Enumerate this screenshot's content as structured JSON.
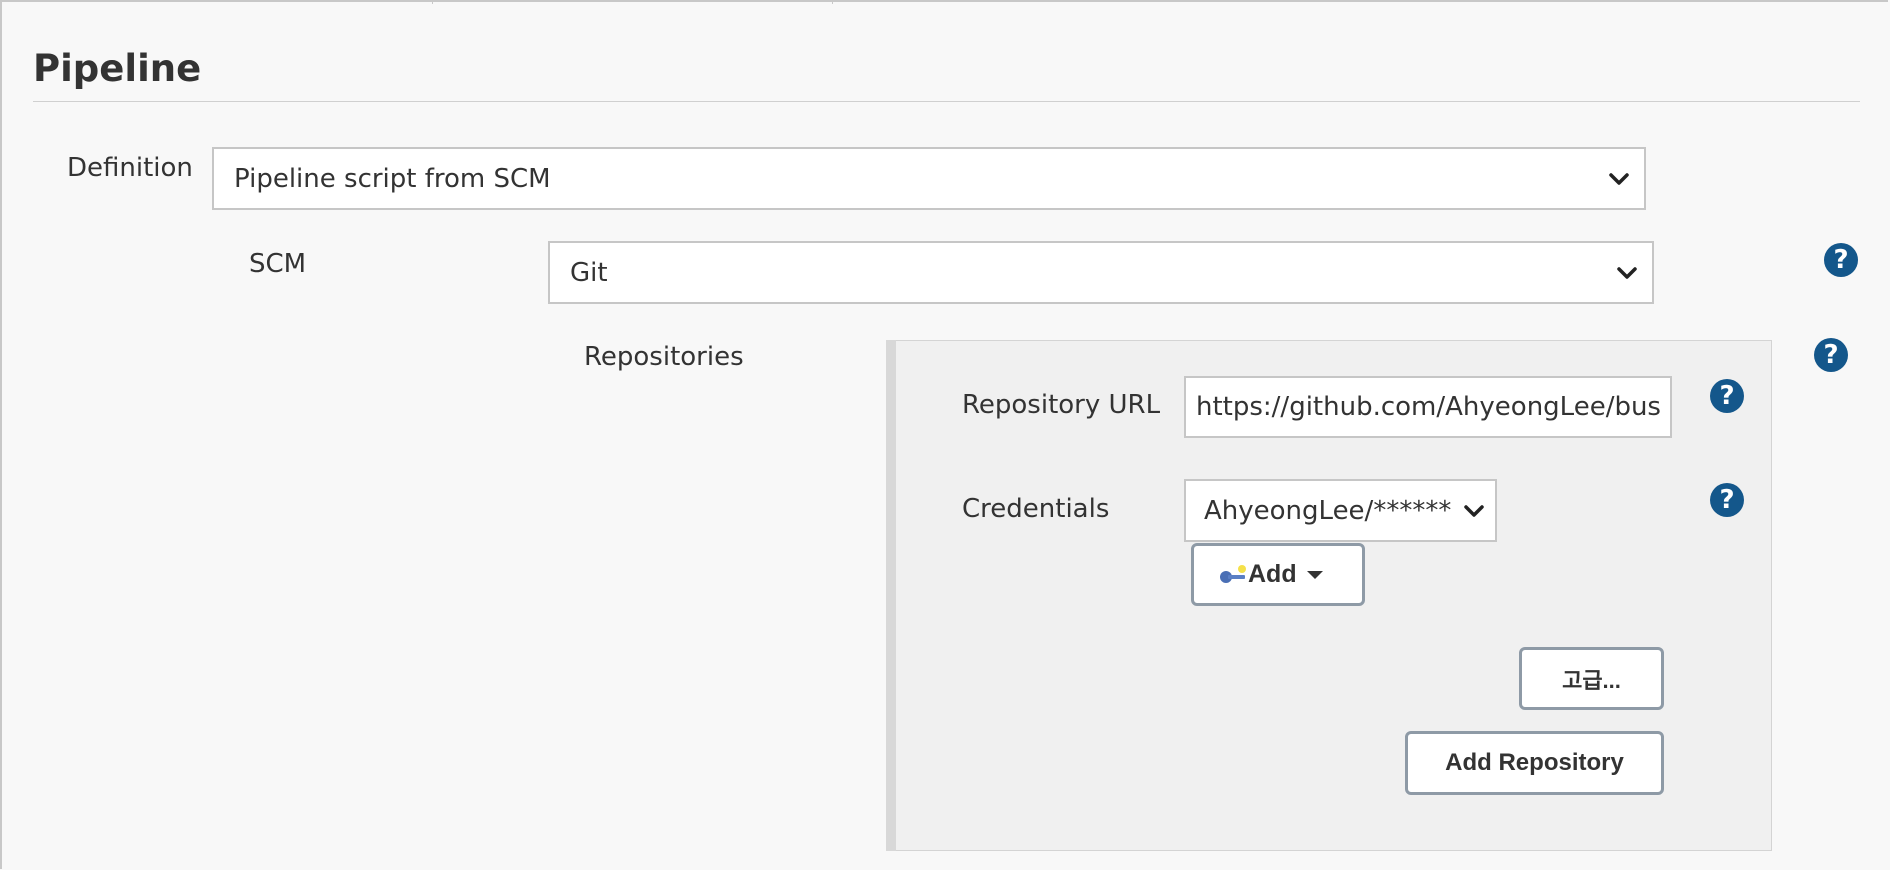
{
  "section": {
    "title": "Pipeline"
  },
  "definition": {
    "label": "Definition",
    "selected": "Pipeline script from SCM"
  },
  "scm": {
    "label": "SCM",
    "selected": "Git"
  },
  "repositories": {
    "label": "Repositories",
    "repository_url": {
      "label": "Repository URL",
      "value": "https://github.com/AhyeongLee/bus"
    },
    "credentials": {
      "label": "Credentials",
      "selected": "AhyeongLee/******",
      "add_label": "Add"
    },
    "advanced_label": "고급...",
    "add_repository_label": "Add Repository"
  },
  "help_glyph": "?",
  "colors": {
    "help_icon": "#14578b",
    "panel_bg": "#f0f0f0",
    "page_bg": "#f8f8f8"
  },
  "icons": {
    "chevron": "chevron-down-icon",
    "help": "help-icon",
    "credentials_key": "key-icon",
    "dropdown_caret": "caret-down-icon"
  }
}
